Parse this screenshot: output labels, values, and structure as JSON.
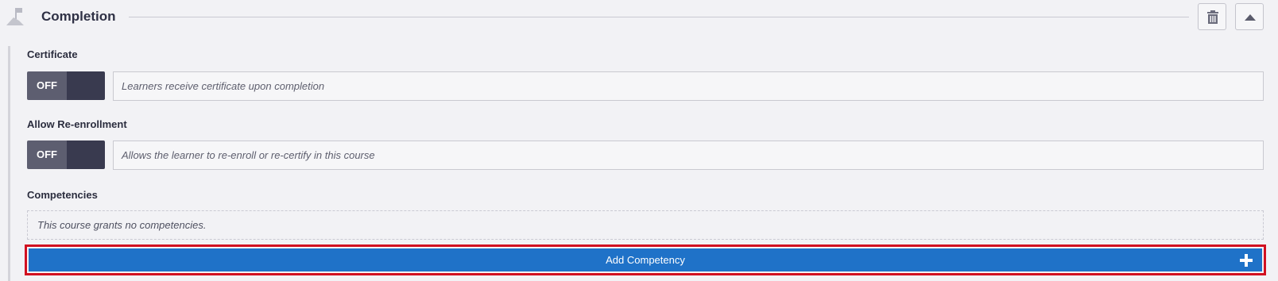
{
  "section": {
    "title": "Completion",
    "icon": "flag-icon",
    "actions": [
      {
        "name": "trash-button",
        "icon": "trash-icon"
      },
      {
        "name": "collapse-button",
        "icon": "caret-up-icon"
      }
    ]
  },
  "certificate": {
    "label": "Certificate",
    "toggle_state": "OFF",
    "description": "Learners receive certificate upon completion"
  },
  "reenrollment": {
    "label": "Allow Re-enrollment",
    "toggle_state": "OFF",
    "description": "Allows the learner to re-enroll or re-certify in this course"
  },
  "competencies": {
    "label": "Competencies",
    "empty_text": "This course grants no competencies.",
    "add_button_label": "Add Competency",
    "add_icon": "plus-icon"
  },
  "colors": {
    "accent": "#1f72c8",
    "highlight_outline": "#d11020",
    "toggle_off": "#5d5e70",
    "toggle_knob": "#393a4f"
  }
}
